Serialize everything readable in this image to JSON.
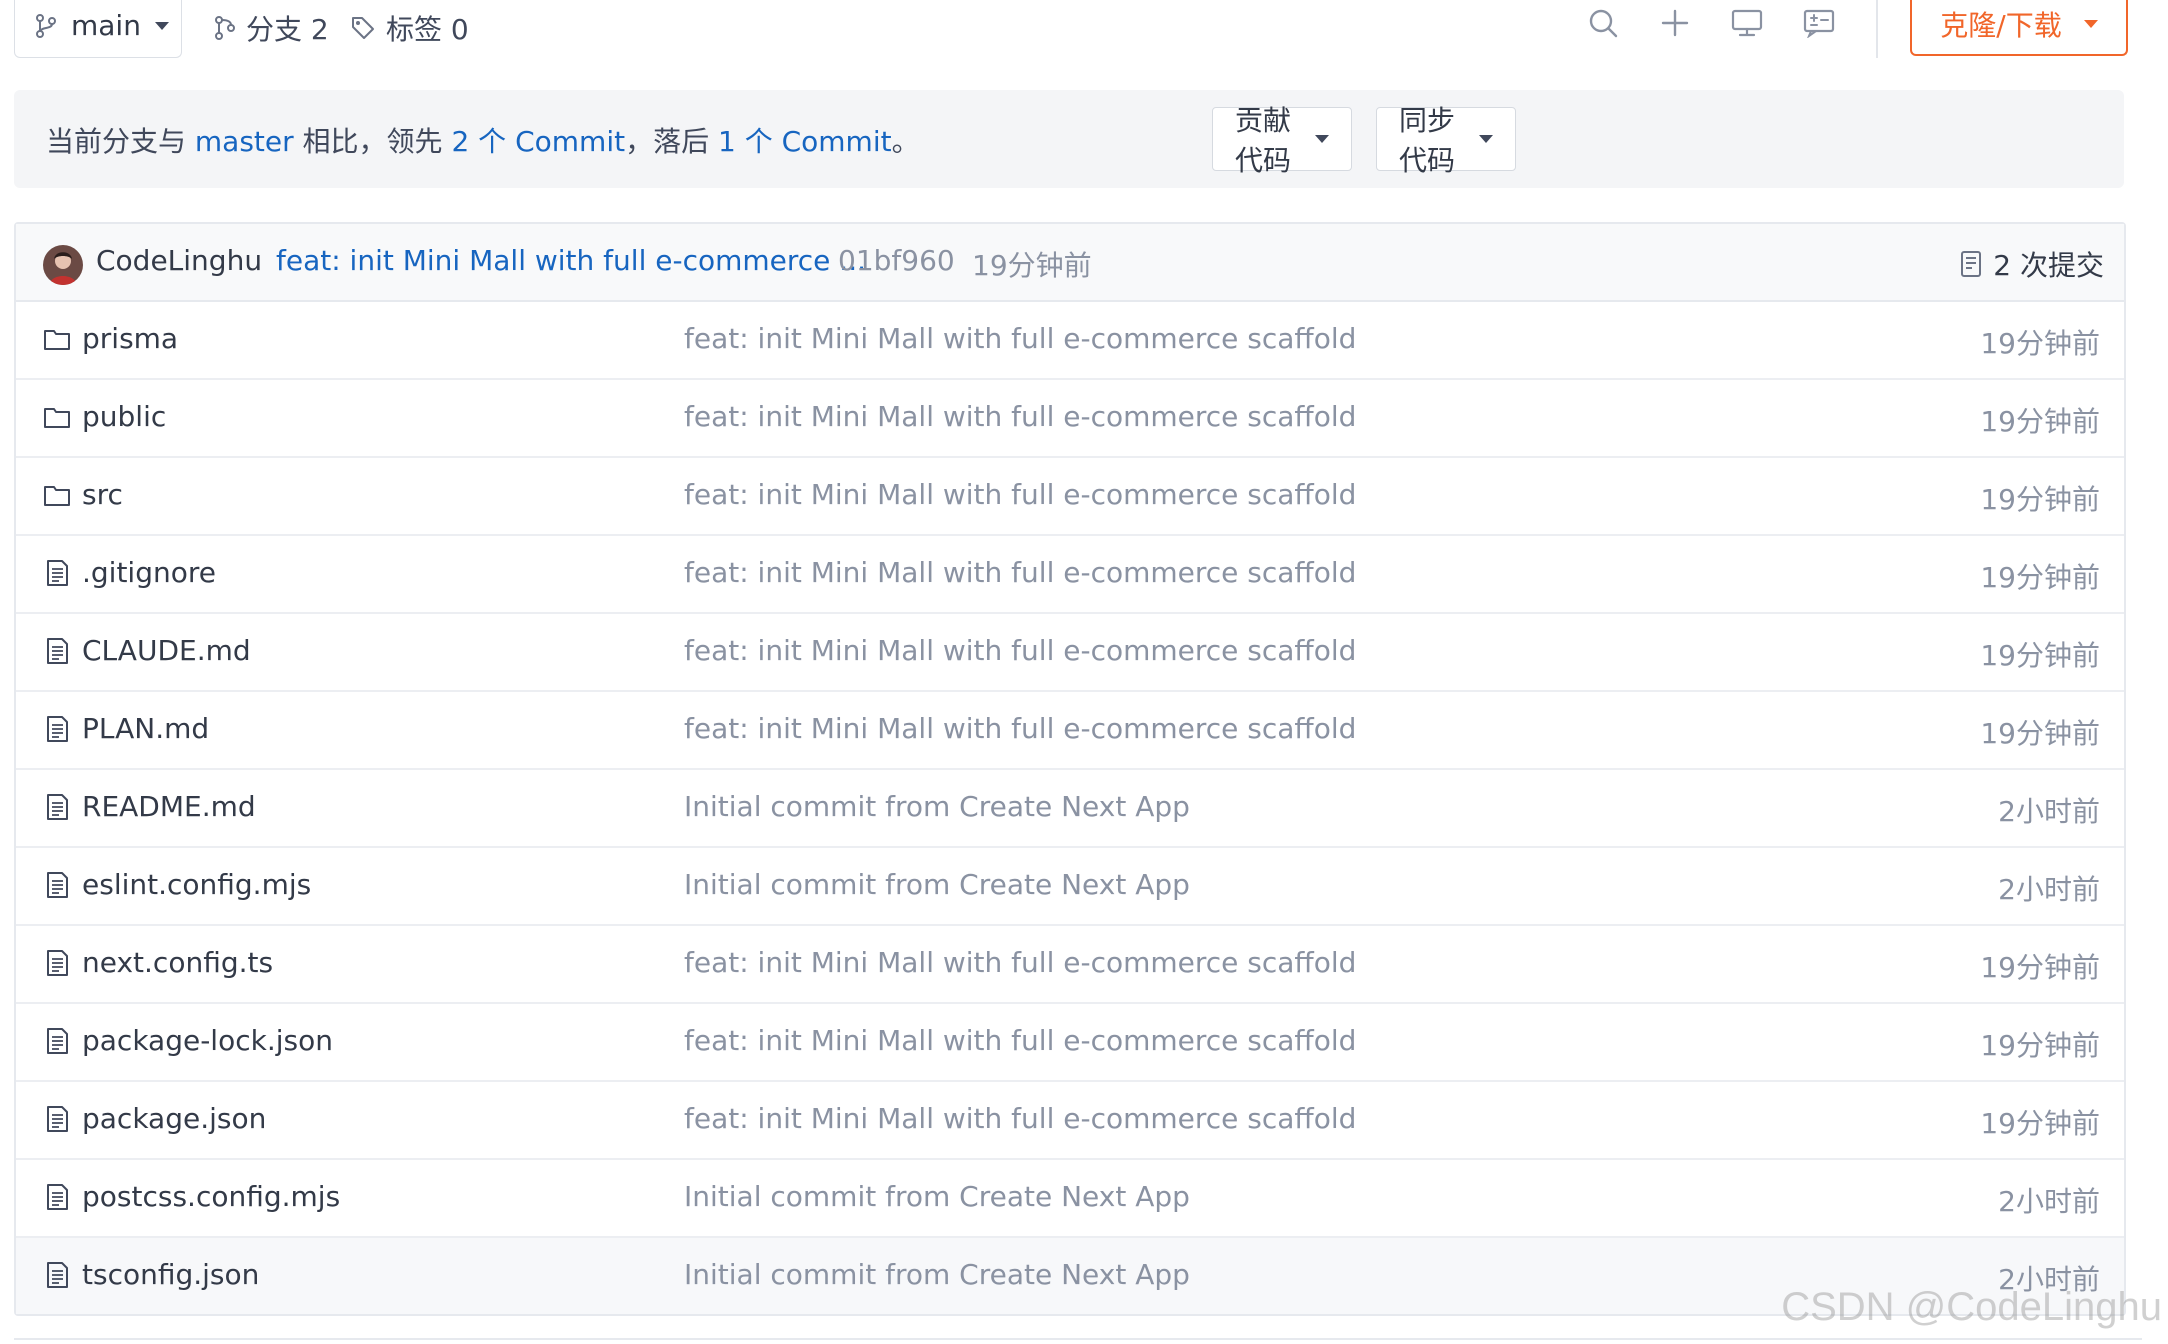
{
  "toolbar": {
    "branch": "main",
    "branches_label": "分支 2",
    "tags_label": "标签 0",
    "clone_label": "克隆/下载",
    "icons": [
      "search-icon",
      "plus-icon",
      "monitor-icon",
      "review-icon"
    ]
  },
  "compare": {
    "prefix": "当前分支与 ",
    "branch": "master",
    "mid1": " 相比，领先 ",
    "ahead": "2 个 Commit",
    "mid2": "，落后 ",
    "behind": "1 个 Commit",
    "suffix": "。",
    "contribute_label": "贡献代码",
    "sync_label": "同步代码"
  },
  "latest_commit": {
    "author": "CodeLinghu",
    "message": "feat: init Mini Mall with full e-commerce ...",
    "sha": "01bf960",
    "time": "19分钟前",
    "count_label": "2 次提交"
  },
  "files": [
    {
      "name": "prisma",
      "type": "folder",
      "message": "feat: init Mini Mall with full e-commerce scaffold",
      "time": "19分钟前"
    },
    {
      "name": "public",
      "type": "folder",
      "message": "feat: init Mini Mall with full e-commerce scaffold",
      "time": "19分钟前"
    },
    {
      "name": "src",
      "type": "folder",
      "message": "feat: init Mini Mall with full e-commerce scaffold",
      "time": "19分钟前"
    },
    {
      "name": ".gitignore",
      "type": "file",
      "message": "feat: init Mini Mall with full e-commerce scaffold",
      "time": "19分钟前"
    },
    {
      "name": "CLAUDE.md",
      "type": "file",
      "message": "feat: init Mini Mall with full e-commerce scaffold",
      "time": "19分钟前"
    },
    {
      "name": "PLAN.md",
      "type": "file",
      "message": "feat: init Mini Mall with full e-commerce scaffold",
      "time": "19分钟前"
    },
    {
      "name": "README.md",
      "type": "file",
      "message": "Initial commit from Create Next App",
      "time": "2小时前"
    },
    {
      "name": "eslint.config.mjs",
      "type": "file",
      "message": "Initial commit from Create Next App",
      "time": "2小时前"
    },
    {
      "name": "next.config.ts",
      "type": "file",
      "message": "feat: init Mini Mall with full e-commerce scaffold",
      "time": "19分钟前"
    },
    {
      "name": "package-lock.json",
      "type": "file",
      "message": "feat: init Mini Mall with full e-commerce scaffold",
      "time": "19分钟前"
    },
    {
      "name": "package.json",
      "type": "file",
      "message": "feat: init Mini Mall with full e-commerce scaffold",
      "time": "19分钟前"
    },
    {
      "name": "postcss.config.mjs",
      "type": "file",
      "message": "Initial commit from Create Next App",
      "time": "2小时前"
    },
    {
      "name": "tsconfig.json",
      "type": "file",
      "message": "Initial commit from Create Next App",
      "time": "2小时前"
    }
  ],
  "colors": {
    "accent_orange": "#f1662a",
    "link_blue": "#1765c0",
    "muted_text": "#8a92a2"
  },
  "watermark": "CSDN @CodeLinghu"
}
